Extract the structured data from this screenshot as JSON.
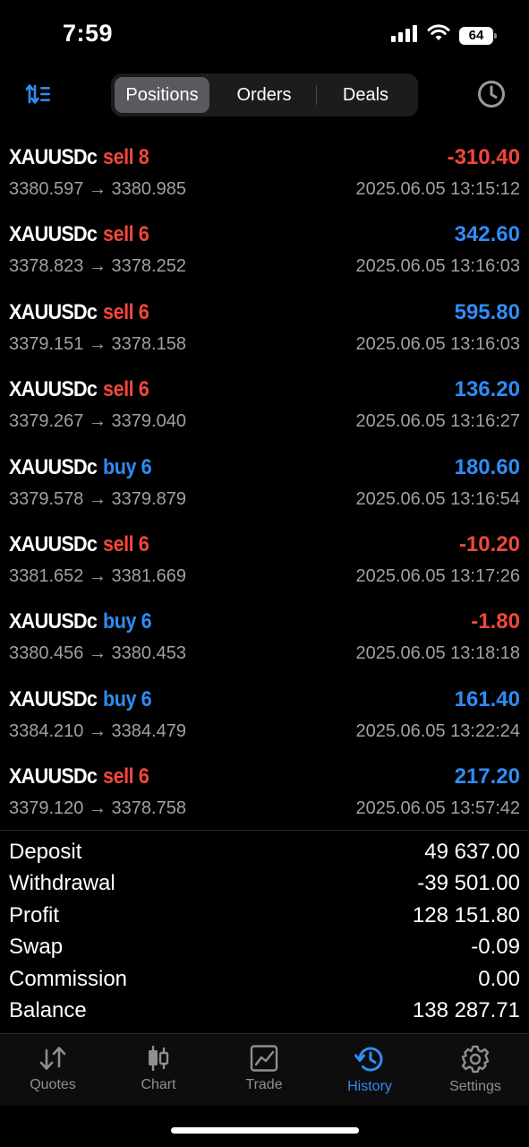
{
  "status_bar": {
    "time": "7:59",
    "battery": "64"
  },
  "top_nav": {
    "segments": [
      "Positions",
      "Orders",
      "Deals"
    ],
    "active_segment": "Positions",
    "sort_icon": "sort-icon",
    "history_icon": "clock-icon"
  },
  "deals": [
    {
      "symbol": "XAUUSDc",
      "side": "sell 8",
      "type": "sell",
      "profit": "-310.40",
      "sign": "neg",
      "prices": "3380.597 → 3380.985",
      "time": "2025.06.05 13:15:12"
    },
    {
      "symbol": "XAUUSDc",
      "side": "sell 6",
      "type": "sell",
      "profit": "342.60",
      "sign": "pos",
      "prices": "3378.823 → 3378.252",
      "time": "2025.06.05 13:16:03"
    },
    {
      "symbol": "XAUUSDc",
      "side": "sell 6",
      "type": "sell",
      "profit": "595.80",
      "sign": "pos",
      "prices": "3379.151 → 3378.158",
      "time": "2025.06.05 13:16:03"
    },
    {
      "symbol": "XAUUSDc",
      "side": "sell 6",
      "type": "sell",
      "profit": "136.20",
      "sign": "pos",
      "prices": "3379.267 → 3379.040",
      "time": "2025.06.05 13:16:27"
    },
    {
      "symbol": "XAUUSDc",
      "side": "buy 6",
      "type": "buy",
      "profit": "180.60",
      "sign": "pos",
      "prices": "3379.578 → 3379.879",
      "time": "2025.06.05 13:16:54"
    },
    {
      "symbol": "XAUUSDc",
      "side": "sell 6",
      "type": "sell",
      "profit": "-10.20",
      "sign": "neg",
      "prices": "3381.652 → 3381.669",
      "time": "2025.06.05 13:17:26"
    },
    {
      "symbol": "XAUUSDc",
      "side": "buy 6",
      "type": "buy",
      "profit": "-1.80",
      "sign": "neg",
      "prices": "3380.456 → 3380.453",
      "time": "2025.06.05 13:18:18"
    },
    {
      "symbol": "XAUUSDc",
      "side": "buy 6",
      "type": "buy",
      "profit": "161.40",
      "sign": "pos",
      "prices": "3384.210 → 3384.479",
      "time": "2025.06.05 13:22:24"
    },
    {
      "symbol": "XAUUSDc",
      "side": "sell 6",
      "type": "sell",
      "profit": "217.20",
      "sign": "pos",
      "prices": "3379.120 → 3378.758",
      "time": "2025.06.05 13:57:42"
    }
  ],
  "summary": [
    {
      "label": "Deposit",
      "value": "49 637.00"
    },
    {
      "label": "Withdrawal",
      "value": "-39 501.00"
    },
    {
      "label": "Profit",
      "value": "128 151.80"
    },
    {
      "label": "Swap",
      "value": "-0.09"
    },
    {
      "label": "Commission",
      "value": "0.00"
    },
    {
      "label": "Balance",
      "value": "138 287.71"
    }
  ],
  "tab_bar": {
    "active": "History",
    "tabs": [
      {
        "label": "Quotes",
        "icon": "quotes-icon"
      },
      {
        "label": "Chart",
        "icon": "candlestick-icon"
      },
      {
        "label": "Trade",
        "icon": "trade-chart-icon"
      },
      {
        "label": "History",
        "icon": "history-icon"
      },
      {
        "label": "Settings",
        "icon": "gear-icon"
      }
    ]
  },
  "colors": {
    "sell": "#f2473b",
    "buy": "#2f8cf6",
    "accent": "#2f8cf6",
    "muted": "#a0a0a5"
  }
}
